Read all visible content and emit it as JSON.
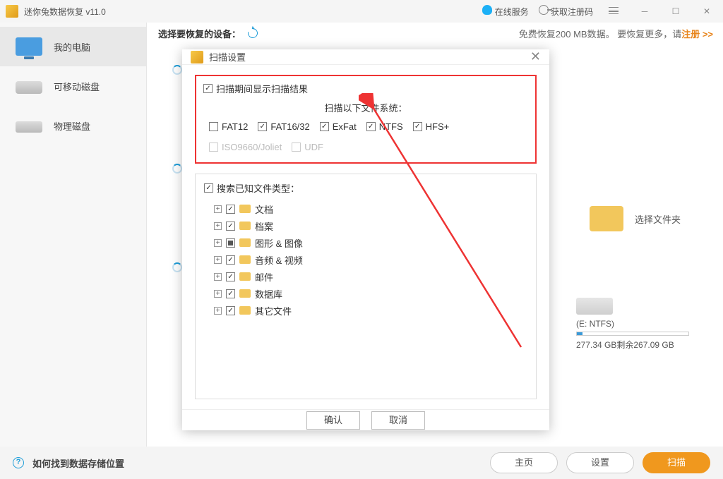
{
  "titlebar": {
    "title": "迷你兔数据恢复 v11.0",
    "online_service": "在线服务",
    "get_code": "获取注册码"
  },
  "subheader": {
    "select_device": "选择要恢复的设备：",
    "promo_a": "免费恢复200 MB数据。 要恢复更多，请",
    "promo_link": "注册 >>"
  },
  "sidebar": {
    "items": [
      {
        "label": "我的电脑"
      },
      {
        "label": "可移动磁盘"
      },
      {
        "label": "物理磁盘"
      }
    ]
  },
  "main": {
    "choose_folder": "选择文件夹",
    "drive_label": "(E: NTFS)",
    "drive_space": "277.34 GB剩余267.09 GB"
  },
  "bottombar": {
    "help": "如何找到数据存储位置",
    "home": "主页",
    "settings": "设置",
    "scan": "扫描"
  },
  "dialog": {
    "title": "扫描设置",
    "show_results": "扫描期间显示扫描结果",
    "fs_title": "扫描以下文件系统：",
    "fs": {
      "fat12": "FAT12",
      "fat1632": "FAT16/32",
      "exfat": "ExFat",
      "ntfs": "NTFS",
      "hfs": "HFS+",
      "iso": "ISO9660/Joliet",
      "udf": "UDF"
    },
    "known_types": "搜索已知文件类型：",
    "tree": {
      "docs": "文档",
      "archive": "档案",
      "graphics": "图形 & 图像",
      "audio": "音频 & 视频",
      "mail": "邮件",
      "database": "数据库",
      "other": "其它文件"
    },
    "ok": "确认",
    "cancel": "取消"
  }
}
